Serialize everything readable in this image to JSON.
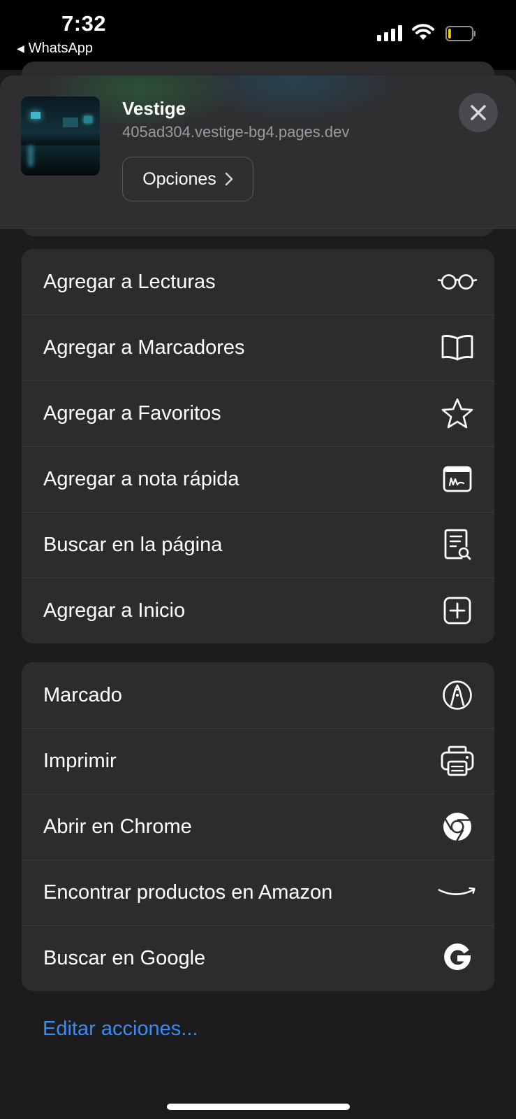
{
  "status_bar": {
    "time": "7:32",
    "back_app": "WhatsApp",
    "back_glyph": "◀"
  },
  "share_header": {
    "title": "Vestige",
    "url": "405ad304.vestige-bg4.pages.dev",
    "options_label": "Opciones",
    "close_icon": "close-icon"
  },
  "group1": [
    {
      "label": "Agregar a Lecturas",
      "icon": "glasses-icon"
    },
    {
      "label": "Agregar a Marcadores",
      "icon": "book-icon"
    },
    {
      "label": "Agregar a Favoritos",
      "icon": "star-icon"
    },
    {
      "label": "Agregar a nota rápida",
      "icon": "quick-note-icon"
    },
    {
      "label": "Buscar en la página",
      "icon": "find-in-page-icon"
    },
    {
      "label": "Agregar a Inicio",
      "icon": "add-square-icon"
    }
  ],
  "group2": [
    {
      "label": "Marcado",
      "icon": "markup-icon"
    },
    {
      "label": "Imprimir",
      "icon": "printer-icon"
    },
    {
      "label": "Abrir en Chrome",
      "icon": "chrome-icon"
    },
    {
      "label": "Encontrar productos en Amazon",
      "icon": "amazon-icon"
    },
    {
      "label": "Buscar en Google",
      "icon": "google-icon"
    }
  ],
  "edit_actions": "Editar acciones...",
  "colors": {
    "background": "#1c1c1e",
    "group_background": "#2c2c2e",
    "link_blue": "#3c8bf0",
    "battery_level": "#f5c518"
  },
  "battery_level_fraction": 0.12
}
